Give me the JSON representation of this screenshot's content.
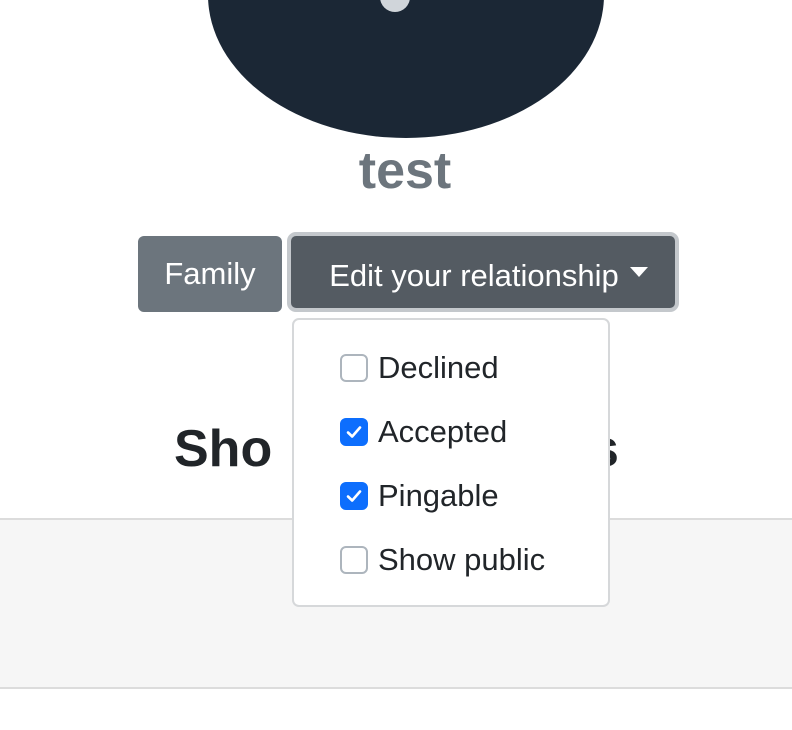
{
  "profile": {
    "username": "test"
  },
  "actions": {
    "family_label": "Family",
    "edit_label": "Edit your relationship"
  },
  "relationship_menu": {
    "options": [
      {
        "label": "Declined",
        "checked": false
      },
      {
        "label": "Accepted",
        "checked": true
      },
      {
        "label": "Pingable",
        "checked": true
      },
      {
        "label": "Show public",
        "checked": false
      }
    ]
  },
  "section": {
    "title_visible_start": "Sho",
    "title_visible_end": "s"
  },
  "colors": {
    "avatar_bg": "#1b2735",
    "secondary_button": "#6c757d",
    "checkbox_checked": "#0d6efd"
  }
}
